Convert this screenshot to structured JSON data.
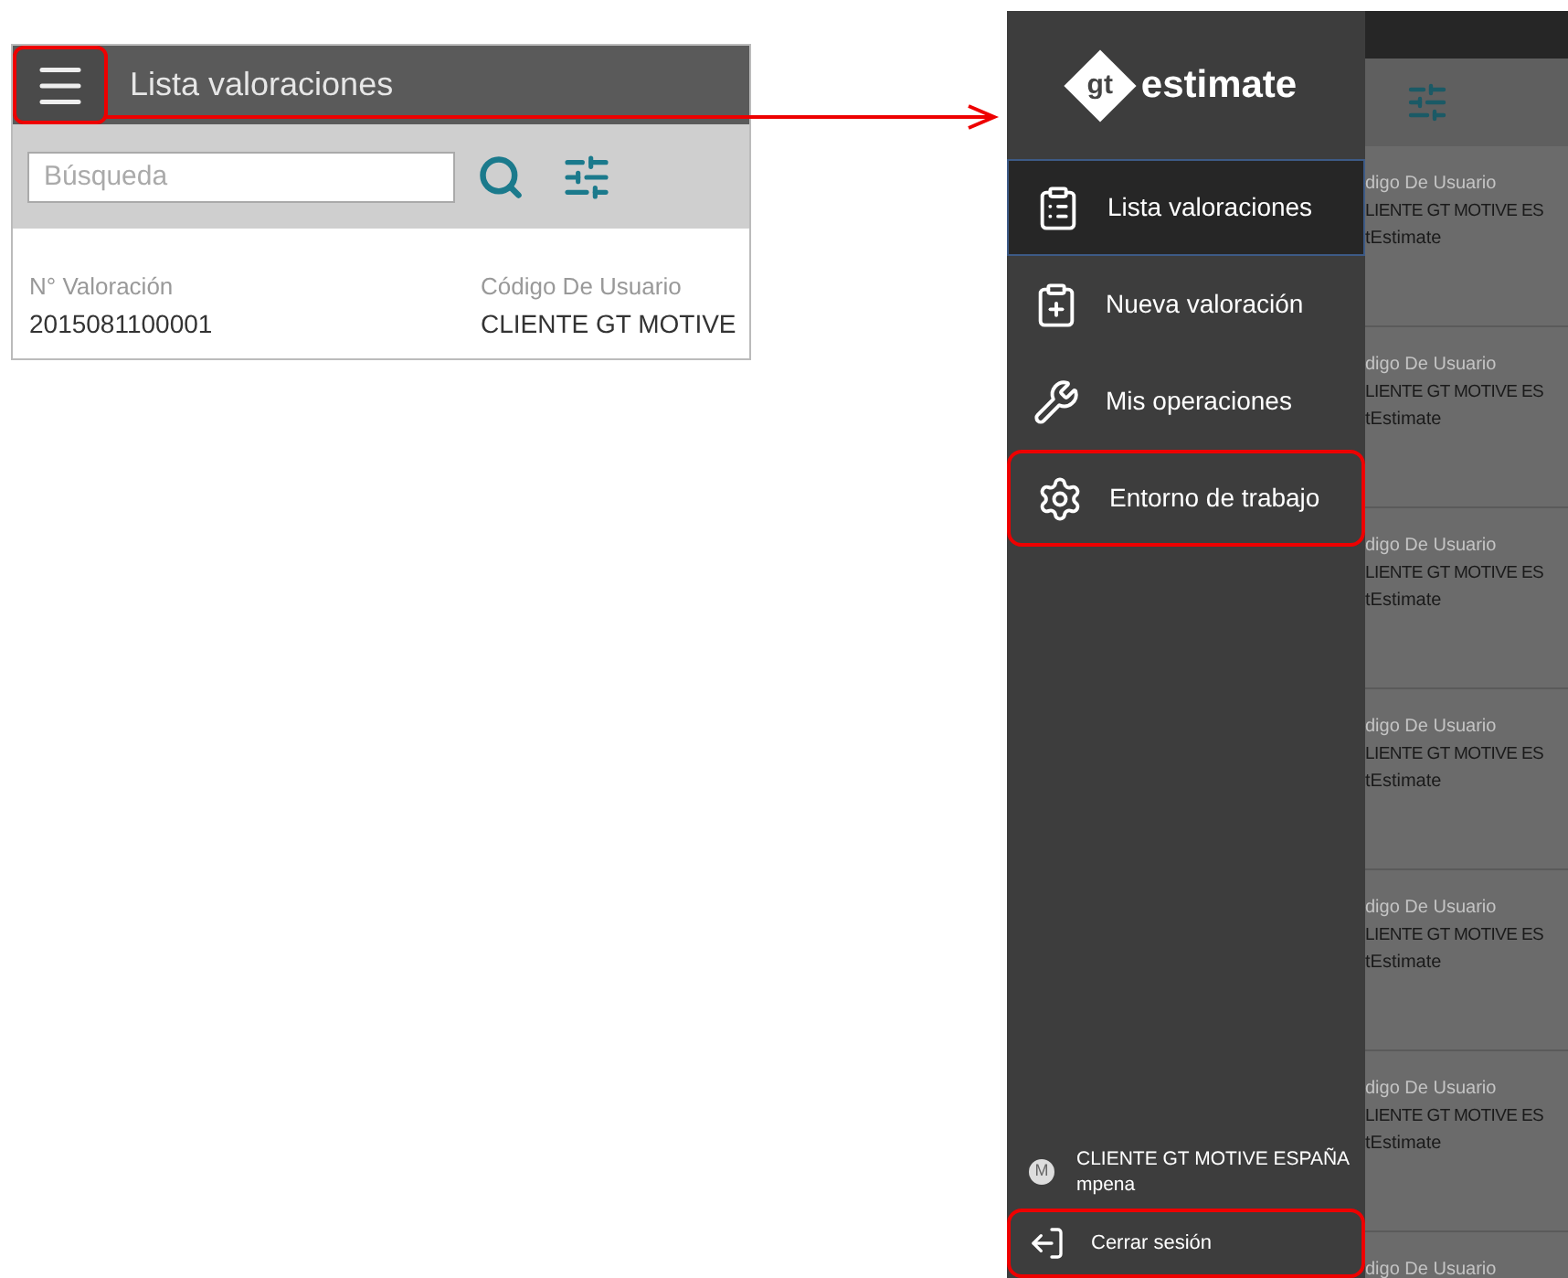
{
  "left_screen": {
    "title": "Lista valoraciones",
    "menu_highlighted": true,
    "search": {
      "placeholder": "Búsqueda"
    },
    "columns": [
      {
        "label": "N°  Valoración",
        "value": "2015081100001"
      },
      {
        "label": "Código De Usuario",
        "value": "CLIENTE GT MOTIVE"
      }
    ]
  },
  "right_screen": {
    "logo": {
      "badge": "gt",
      "text": "estimate"
    },
    "menu": [
      {
        "kind": "list",
        "label": "Lista valoraciones",
        "selected": true,
        "highlighted": false
      },
      {
        "kind": "new",
        "label": "Nueva valoración",
        "selected": false,
        "highlighted": false
      },
      {
        "kind": "operations",
        "label": "Mis operaciones",
        "selected": false,
        "highlighted": false
      },
      {
        "kind": "settings",
        "label": "Entorno de trabajo",
        "selected": false,
        "highlighted": true
      }
    ],
    "user": {
      "initial": "M",
      "company": "CLIENTE GT MOTIVE ESPAÑA",
      "username": "mpena"
    },
    "logout": {
      "label": "Cerrar sesión",
      "highlighted": true
    },
    "background_rows": [
      {
        "label": "digo De Usuario",
        "value": "LIENTE GT MOTIVE ES",
        "detail": "tEstimate"
      },
      {
        "label": "digo De Usuario",
        "value": "LIENTE GT MOTIVE ES",
        "detail": "tEstimate"
      },
      {
        "label": "digo De Usuario",
        "value": "LIENTE GT MOTIVE ES",
        "detail": "tEstimate"
      },
      {
        "label": "digo De Usuario",
        "value": "LIENTE GT MOTIVE ES",
        "detail": "tEstimate"
      },
      {
        "label": "digo De Usuario",
        "value": "LIENTE GT MOTIVE ES",
        "detail": "tEstimate"
      },
      {
        "label": "digo De Usuario",
        "value": "LIENTE GT MOTIVE ES",
        "detail": "tEstimate"
      },
      {
        "label": "digo De Usuario"
      }
    ]
  }
}
